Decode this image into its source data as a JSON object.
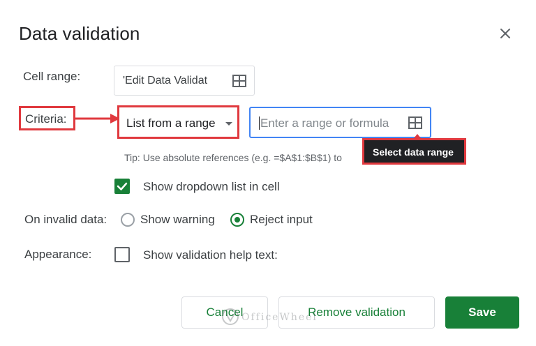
{
  "dialog": {
    "title": "Data validation",
    "close_icon": "close-icon"
  },
  "cell_range": {
    "label": "Cell range:",
    "value": "'Edit Data Validat",
    "icon": "grid-icon"
  },
  "criteria": {
    "label": "Criteria:",
    "dropdown_value": "List from a range",
    "range_placeholder": "Enter a range or formula",
    "range_icon": "grid-icon"
  },
  "tip": {
    "text": "Tip: Use absolute references (e.g. =$A$1:$B$1) to"
  },
  "tooltip": {
    "text": "Select data range"
  },
  "show_dropdown": {
    "label": "Show dropdown list in cell",
    "checked": true
  },
  "invalid_data": {
    "label": "On invalid data:",
    "options": [
      {
        "label": "Show warning",
        "selected": false
      },
      {
        "label": "Reject input",
        "selected": true
      }
    ]
  },
  "appearance": {
    "label": "Appearance:",
    "help_text_label": "Show validation help text:",
    "checked": false
  },
  "buttons": {
    "cancel": "Cancel",
    "remove": "Remove validation",
    "save": "Save"
  },
  "watermark": {
    "text": "OfficeWheel"
  },
  "colors": {
    "accent_green": "#188038",
    "highlight_red": "#e0393e",
    "focus_blue": "#4285f4",
    "tooltip_bg": "#202124"
  }
}
